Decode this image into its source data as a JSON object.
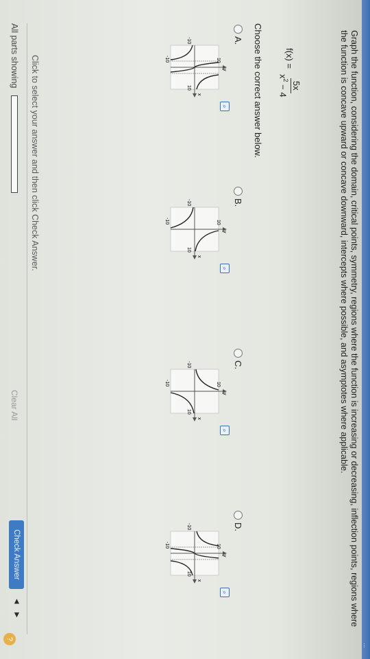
{
  "header": {
    "help_text": "..."
  },
  "instructions": "Graph the function, considering the domain, critical points, symmetry, regions where the function is increasing or decreasing, inflection points, regions where the function is concave upward or concave downward, intercepts where possible, and asymptotes where applicable.",
  "function": {
    "lhs": "f(x) =",
    "numerator": "5x",
    "denominator_base": "x",
    "denominator_exp": "2",
    "denominator_rest": " − 4"
  },
  "prompt": "Choose the correct answer below.",
  "options": [
    {
      "label": "A.",
      "graph": {
        "x_label": "x",
        "y_label": "y",
        "x_min_label": "-10",
        "x_max_label": "10",
        "y_max_label": "10",
        "y_min_label": "-10"
      }
    },
    {
      "label": "B.",
      "graph": {
        "x_label": "x",
        "y_label": "y",
        "x_min_label": "-10",
        "x_max_label": "10",
        "y_max_label": "10",
        "y_min_label": "-10"
      }
    },
    {
      "label": "C.",
      "graph": {
        "x_label": "x",
        "y_label": "y",
        "x_min_label": "-10",
        "x_max_label": "10",
        "y_max_label": "10",
        "y_min_label": "-10"
      }
    },
    {
      "label": "D.",
      "graph": {
        "x_label": "x",
        "y_label": "y",
        "x_min_label": "-10",
        "x_max_label": "10",
        "y_max_label": "10",
        "y_min_label": "-10"
      }
    }
  ],
  "footer": {
    "hint": "Click to select your answer and then click Check Answer.",
    "parts_label": "All parts showing",
    "clear_all": "Clear All",
    "check_answer": "Check Answer",
    "prev_arrow": "◄",
    "next_arrow": "►",
    "help_symbol": "?"
  },
  "icons": {
    "zoom": "magnifier-icon",
    "radio": "radio-circle"
  },
  "colors": {
    "accent": "#3f7bc4",
    "topbar": "#3f6fb0",
    "help": "#e6b04a"
  }
}
